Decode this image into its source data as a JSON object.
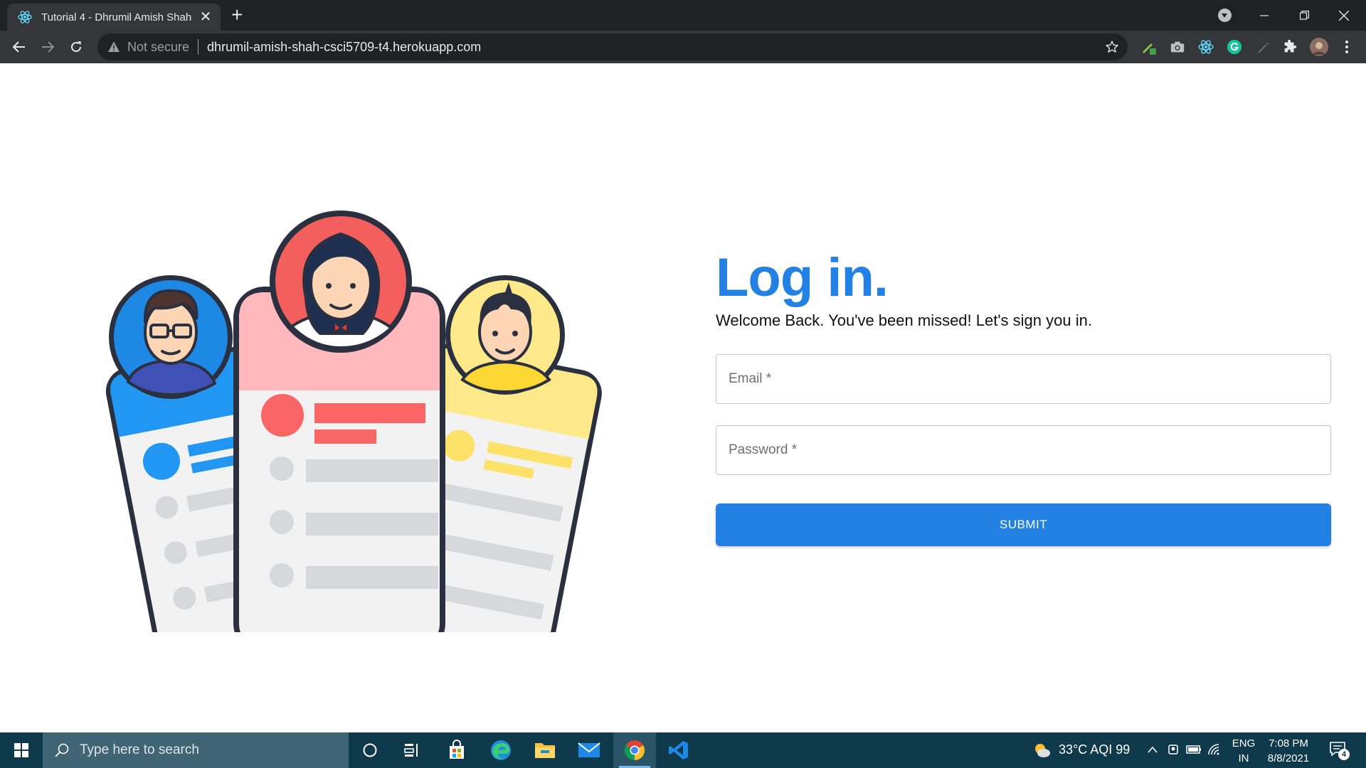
{
  "browser": {
    "tab_title": "Tutorial 4 - Dhrumil Amish Shah",
    "security_label": "Not secure",
    "url": "dhrumil-amish-shah-csci5709-t4.herokuapp.com"
  },
  "login": {
    "heading": "Log in.",
    "subtitle": "Welcome Back. You've been missed! Let's sign you in.",
    "email_placeholder": "Email *",
    "password_placeholder": "Password *",
    "submit_label": "SUBMIT",
    "accent_color": "#2281e3"
  },
  "taskbar": {
    "search_placeholder": "Type here to search",
    "weather": "33°C  AQI 99",
    "lang_line1": "ENG",
    "lang_line2": "IN",
    "time": "7:08 PM",
    "date": "8/8/2021",
    "notification_count": "4"
  }
}
